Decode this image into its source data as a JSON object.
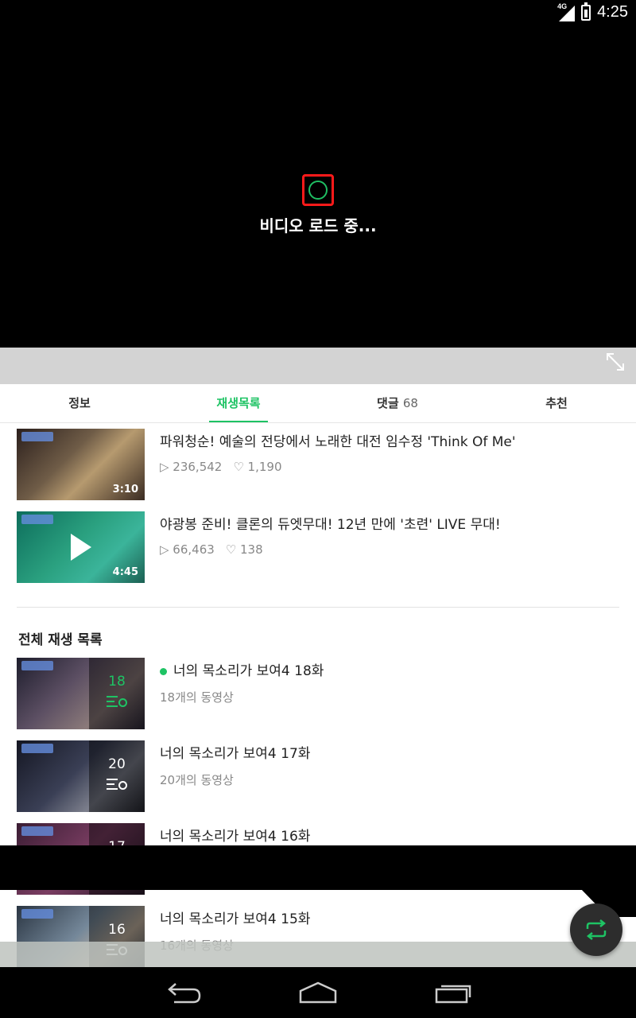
{
  "status_bar": {
    "network": "4G",
    "time": "4:25"
  },
  "player": {
    "loading_text": "비디오 로드 중..."
  },
  "tabs": [
    {
      "label": "정보",
      "count": ""
    },
    {
      "label": "재생목록",
      "count": ""
    },
    {
      "label": "댓글",
      "count": "68"
    },
    {
      "label": "추천",
      "count": ""
    }
  ],
  "active_tab": "재생목록",
  "related": [
    {
      "title": "파워청순! 예술의 전당에서 노래한 대전 임수정 'Think Of Me'",
      "duration": "3:10",
      "views": "▷ 236,542",
      "likes": "♡ 1,190"
    },
    {
      "title": "야광봉 준비! 클론의 듀엣무대! 12년 만에 '초련' LIVE 무대!",
      "duration": "4:45",
      "views": "▷ 66,463",
      "likes": "♡ 138"
    }
  ],
  "playlist_section": {
    "title": "전체 재생 목록"
  },
  "playlists": [
    {
      "title": "너의 목소리가 보여4 18화",
      "count": "18",
      "subtitle": "18개의 동영상",
      "current": true
    },
    {
      "title": "너의 목소리가 보여4 17화",
      "count": "20",
      "subtitle": "20개의 동영상",
      "current": false
    },
    {
      "title": "너의 목소리가 보여4 16화",
      "count": "17",
      "subtitle": "",
      "current": false
    },
    {
      "title": "너의 목소리가 보여4 15화",
      "count": "16",
      "subtitle": "16개의 동영상",
      "current": false
    }
  ],
  "colors": {
    "accent": "#1ec364",
    "spinner_highlight": "#ff1a1a"
  },
  "icons": [
    "expand-icon",
    "repeat-icon",
    "back-icon",
    "home-icon",
    "recents-icon",
    "play-icon",
    "playlist-icon"
  ]
}
